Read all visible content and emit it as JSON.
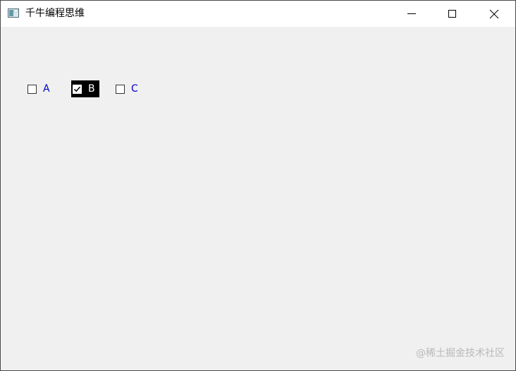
{
  "window": {
    "title": "千牛编程思维",
    "icon": "app-window-icon",
    "controls": {
      "minimize": "minimize-icon",
      "maximize": "maximize-icon",
      "close": "close-icon"
    }
  },
  "checkboxes": [
    {
      "label": "A",
      "checked": false,
      "label_color": "#0000c8"
    },
    {
      "label": "B",
      "checked": true,
      "highlighted": true,
      "label_color": "#ffffff",
      "background": "#000000"
    },
    {
      "label": "C",
      "checked": false,
      "label_color": "#0000c8"
    }
  ],
  "watermark": "@稀土掘金技术社区",
  "colors": {
    "client_background": "#f0f0f0",
    "titlebar_background": "#ffffff"
  }
}
